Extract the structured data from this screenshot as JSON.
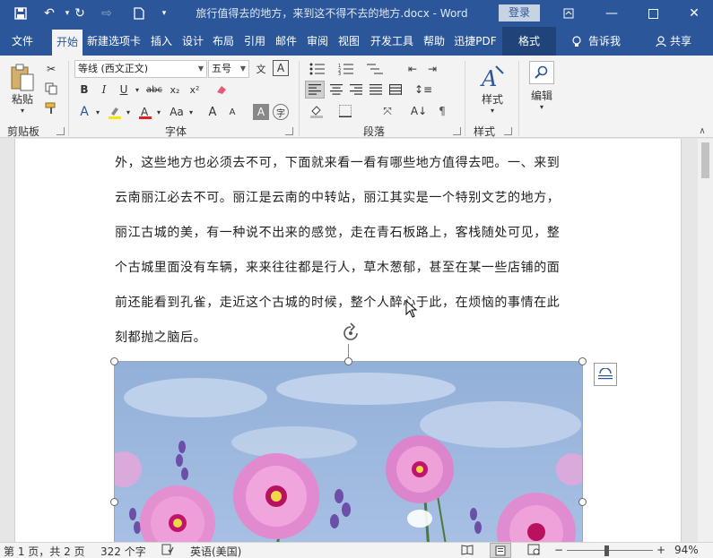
{
  "titlebar": {
    "doc_title": "旅行值得去的地方，来到这不得不去的地方.docx - Word",
    "login_label": "登录",
    "quick_access": [
      "save-icon",
      "undo-icon",
      "redo-icon",
      "repeat-icon",
      "new-doc-icon",
      "customize-icon"
    ]
  },
  "tabs": {
    "file": "文件",
    "home": "开始",
    "newtab": "新建选项卡",
    "insert": "插入",
    "design": "设计",
    "layout": "布局",
    "references": "引用",
    "mailings": "邮件",
    "review": "审阅",
    "view": "视图",
    "developer": "开发工具",
    "help": "帮助",
    "pdf": "迅捷PDF",
    "format": "格式",
    "tellme": "告诉我",
    "share": "共享"
  },
  "ribbon": {
    "clipboard": {
      "paste": "粘贴",
      "label": "剪贴板"
    },
    "font": {
      "label": "字体",
      "font_name": "等线 (西文正文)",
      "font_size": "五号",
      "bold": "B",
      "italic": "I",
      "underline": "U",
      "strike": "abc",
      "subscript": "x₂",
      "superscript": "x²",
      "grow": "A",
      "shrink": "A",
      "aa": "Aa",
      "char_border": "A",
      "phonetic": "文"
    },
    "paragraph": {
      "label": "段落"
    },
    "styles": {
      "label": "样式",
      "button": "样式"
    },
    "editing": {
      "button": "编辑"
    }
  },
  "document": {
    "lines": [
      "外，这些地方也必须去不可，下面就来看一看有哪些地方值得去吧。一、来到",
      "云南丽江必去不可。丽江是云南的中转站，丽江其实是一个特别文艺的地方，",
      "丽江古城的美，有一种说不出来的感觉，走在青石板路上，客栈随处可见，整",
      "个古城里面没有车辆，来来往往都是行人，草木葱郁，甚至在某一些店铺的面",
      "前还能看到孔雀，走近这个古城的时候，整个人醉心于此，在烦恼的事情在此",
      "刻都抛之脑后。"
    ]
  },
  "statusbar": {
    "page": "第 1 页，共 2 页",
    "words": "322 个字",
    "language": "英语(美国)",
    "zoom": "94%",
    "minus": "−",
    "plus": "+"
  },
  "colors": {
    "accent": "#2b579a",
    "ribbon_bg": "#f3f3f3",
    "workspace": "#e6e6e6"
  }
}
